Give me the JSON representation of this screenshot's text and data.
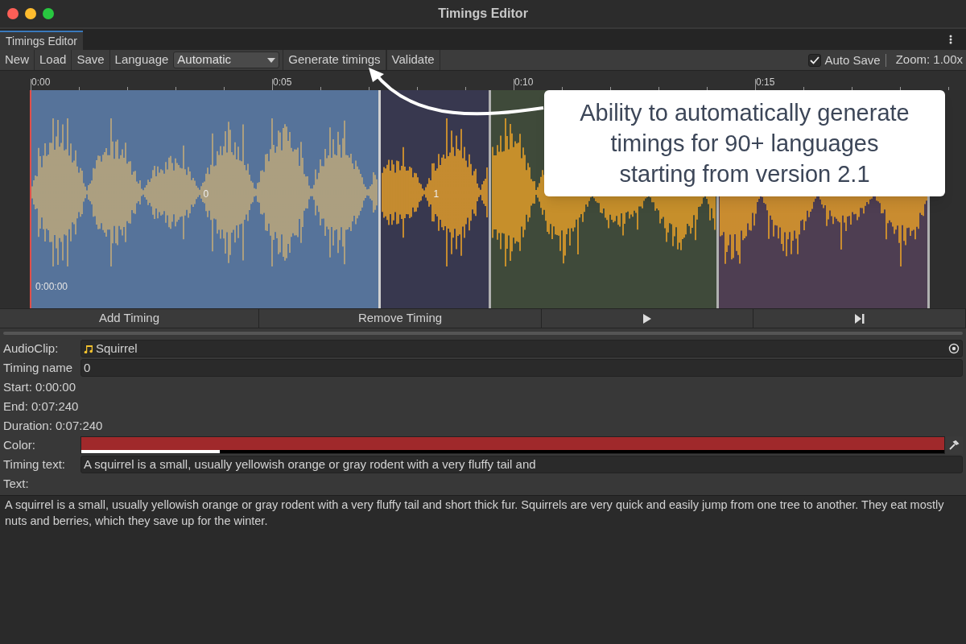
{
  "window": {
    "title": "Timings Editor"
  },
  "tabs": [
    {
      "label": "Timings Editor",
      "selected": true
    }
  ],
  "toolbar": {
    "buttons": [
      "New",
      "Load",
      "Save"
    ],
    "language_label": "Language",
    "language_value": "Automatic",
    "actions": [
      "Generate timings",
      "Validate"
    ],
    "auto_save": {
      "label": "Auto Save",
      "checked": true
    },
    "zoom": "Zoom: 1.00x"
  },
  "ruler": {
    "ticks": [
      "0:00",
      "0:05",
      "0:10",
      "0:15"
    ]
  },
  "timeline": {
    "start_time": "0:00:00",
    "segments": [
      {
        "label": "0",
        "color": "#56739a",
        "selected": true
      },
      {
        "label": "1",
        "color": "#38384f",
        "selected": false
      },
      {
        "color": "#3f4a3a",
        "selected": false
      },
      {
        "color": "#4e3e52",
        "selected": false
      }
    ]
  },
  "callout": "Ability to automatically generate timings for 90+ languages starting from version 2.1",
  "controls": [
    {
      "kind": "text",
      "label": "Add Timing"
    },
    {
      "kind": "text",
      "label": "Remove Timing"
    },
    {
      "kind": "play"
    },
    {
      "kind": "skip"
    }
  ],
  "fields": [
    {
      "kind": "object",
      "label": "AudioClip:",
      "value": "Squirrel"
    },
    {
      "kind": "text",
      "label": "Timing name",
      "value": "0"
    },
    {
      "kind": "info",
      "label": "Start: 0:00:00"
    },
    {
      "kind": "info",
      "label": "End: 0:07:240"
    },
    {
      "kind": "info",
      "label": "Duration: 0:07:240"
    },
    {
      "kind": "color",
      "label": "Color:",
      "color": "#a0292b",
      "level": 0.16
    },
    {
      "kind": "text",
      "label": "Timing text:",
      "value": "A squirrel is a small, usually yellowish orange or gray rodent with a very fluffy tail and"
    },
    {
      "kind": "info",
      "label": "Text:"
    }
  ],
  "text_area": "A squirrel is a small, usually yellowish orange or gray rodent with a very fluffy tail and short thick fur. Squirrels are very quick and easily jump from one tree to another. They eat mostly nuts and berries, which they save up for the winter."
}
